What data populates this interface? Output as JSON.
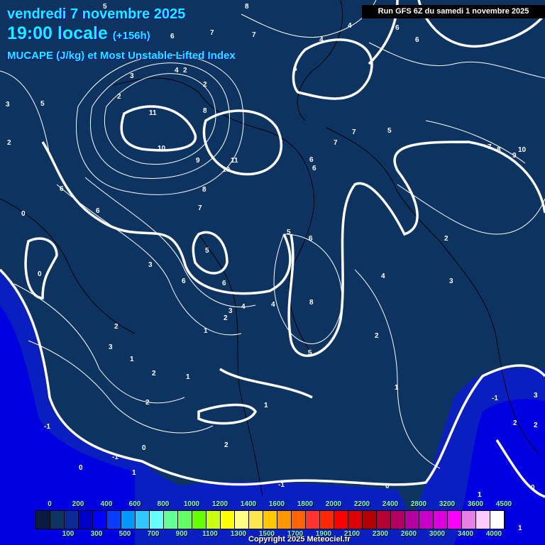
{
  "header": {
    "date": "vendredi 7 novembre 2025",
    "time": "19:00 locale",
    "lead": "(+156h)",
    "product": "MUCAPE (J/kg) et Most Unstable Lifted Index",
    "run": "Run GFS 6Z du samedi 1 novembre 2025"
  },
  "legend": {
    "colors": [
      "#0a1a40",
      "#0d3461",
      "#0a2a96",
      "#0000c8",
      "#0000ff",
      "#0a3cff",
      "#0096ff",
      "#32c8ff",
      "#64ffff",
      "#64ff96",
      "#64ff64",
      "#64ff00",
      "#c8ff14",
      "#ffff00",
      "#ffff80",
      "#ffe650",
      "#ffc800",
      "#ff9600",
      "#ff6400",
      "#ff3232",
      "#ff2800",
      "#ff0000",
      "#dc0000",
      "#b40000",
      "#b40032",
      "#b40064",
      "#b400a0",
      "#c800c8",
      "#dc00dc",
      "#ff00ff",
      "#e680e6",
      "#ffc8ff",
      "#ffffff"
    ],
    "top_labels": [
      "0",
      "200",
      "400",
      "600",
      "800",
      "1000",
      "1200",
      "1400",
      "1600",
      "1800",
      "2000",
      "2200",
      "2400",
      "2800",
      "3200",
      "3600",
      "4500"
    ],
    "bottom_labels": [
      "100",
      "300",
      "500",
      "700",
      "900",
      "1100",
      "1300",
      "1500",
      "1700",
      "1900",
      "2100",
      "2300",
      "2600",
      "3000",
      "3400",
      "4000"
    ]
  },
  "contour_labels": [
    "5",
    "8",
    "6",
    "7",
    "7",
    "4",
    "4",
    "6",
    "6",
    "3",
    "2",
    "4",
    "2",
    "2",
    "8",
    "5",
    "11",
    "10",
    "9",
    "10",
    "11",
    "8",
    "7",
    "6",
    "6",
    "3",
    "2",
    "6",
    "7",
    "7",
    "5",
    "6",
    "6",
    "7",
    "8",
    "10",
    "9",
    "0",
    "0",
    "5",
    "5",
    "6",
    "3",
    "6",
    "6",
    "4",
    "4",
    "8",
    "3",
    "2",
    "3",
    "2",
    "1",
    "2",
    "1",
    "1",
    "2",
    "2",
    "2",
    "1",
    "0",
    "0",
    "1",
    "-1",
    "-1",
    "5",
    "1",
    "2",
    "4",
    "3",
    "-1",
    "2",
    "2",
    "3",
    "0",
    "0",
    "1",
    "-1",
    "1"
  ],
  "copyright": "Copyright 2025 Meteociel.fr"
}
